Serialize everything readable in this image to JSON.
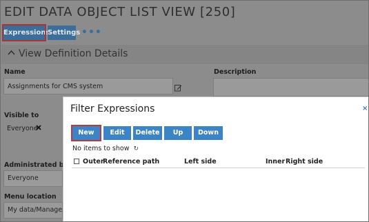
{
  "page": {
    "title": "EDIT DATA OBJECT LIST VIEW [250]"
  },
  "tabs": [
    {
      "label": "Expressions",
      "active": true
    },
    {
      "label": "Settings",
      "active": false
    }
  ],
  "more": {
    "label": "•••"
  },
  "section": {
    "title": "View Definition Details",
    "chevron": "^"
  },
  "fields": {
    "name": {
      "label": "Name",
      "value": "Assignments for CMS system"
    },
    "description": {
      "label": "Description",
      "value": ""
    },
    "visible_to": {
      "label": "Visible to",
      "value": "Everyone"
    },
    "administrated_by": {
      "label": "Administrated by",
      "value": "Everyone"
    },
    "menu_location": {
      "label": "Menu location",
      "value": "My data/Manage"
    }
  },
  "modal": {
    "title": "Filter Expressions",
    "close": "×",
    "buttons": {
      "new": "New",
      "edit": "Edit",
      "delete": "Delete",
      "up": "Up",
      "down": "Down"
    },
    "empty_message": "No items to show",
    "refresh": "↻",
    "columns": [
      "Outer",
      "Reference path",
      "Left side",
      "Inner",
      "Right side"
    ]
  },
  "colors": {
    "button": "#3d84c6",
    "highlight": "#b83a3a",
    "tab": "#3c6e99"
  },
  "icons": {
    "edit": "pencil-square-icon",
    "remove": "close-x-icon",
    "refresh": "refresh-icon",
    "chevron": "chevron-up-icon"
  }
}
